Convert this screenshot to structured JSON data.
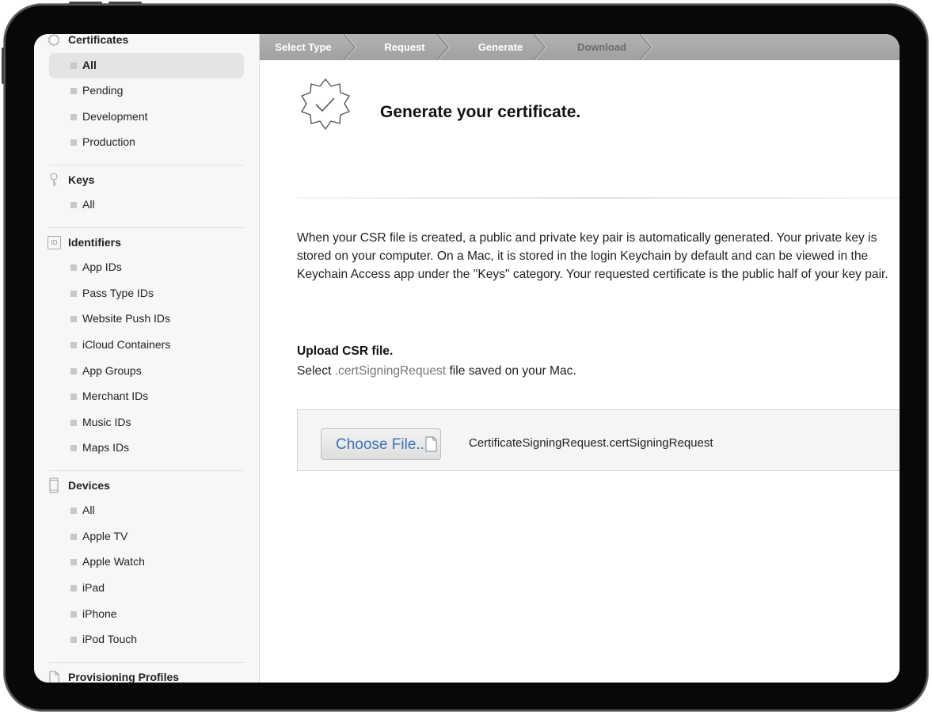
{
  "sidebar": {
    "certificates": {
      "title": "Certificates",
      "icon": "certificate-seal-icon",
      "items": [
        {
          "label": "All",
          "active": true
        },
        {
          "label": "Pending"
        },
        {
          "label": "Development"
        },
        {
          "label": "Production"
        }
      ]
    },
    "keys": {
      "title": "Keys",
      "icon": "key-icon",
      "items": [
        {
          "label": "All"
        }
      ]
    },
    "identifiers": {
      "title": "Identifiers",
      "icon": "id-badge-icon",
      "icon_text": "ID",
      "items": [
        {
          "label": "App IDs"
        },
        {
          "label": "Pass Type IDs"
        },
        {
          "label": "Website Push IDs"
        },
        {
          "label": "iCloud Containers"
        },
        {
          "label": "App Groups"
        },
        {
          "label": "Merchant IDs"
        },
        {
          "label": "Music IDs"
        },
        {
          "label": "Maps IDs"
        }
      ]
    },
    "devices": {
      "title": "Devices",
      "icon": "device-phone-icon",
      "items": [
        {
          "label": "All"
        },
        {
          "label": "Apple TV"
        },
        {
          "label": "Apple Watch"
        },
        {
          "label": "iPad"
        },
        {
          "label": "iPhone"
        },
        {
          "label": "iPod Touch"
        }
      ]
    },
    "profiles": {
      "title": "Provisioning Profiles",
      "icon": "document-icon"
    }
  },
  "stepper": {
    "steps": [
      {
        "label": "Select Type",
        "state": "done"
      },
      {
        "label": "Request",
        "state": "done"
      },
      {
        "label": "Generate",
        "state": "current"
      },
      {
        "label": "Download",
        "state": "pending"
      }
    ]
  },
  "main": {
    "heading": "Generate your certificate.",
    "description": "When your CSR file is created, a public and private key pair is automatically generated. Your private key is stored on your computer. On a Mac, it is stored in the login Keychain by default and can be viewed in the Keychain Access app under the \"Keys\" category. Your requested certificate is the public half of your key pair.",
    "upload": {
      "title": "Upload CSR file.",
      "subtitle_prefix": "Select ",
      "subtitle_ext": ".certSigningRequest",
      "subtitle_suffix": " file saved on your Mac.",
      "choose_button": "Choose File...",
      "filename": "CertificateSigningRequest.certSigningRequest"
    }
  },
  "colors": {
    "stepper_bg": "#a8a8a8",
    "link_blue": "#3d73b6",
    "sidebar_bg": "#f7f7f7",
    "device_bezel": "#080808"
  }
}
